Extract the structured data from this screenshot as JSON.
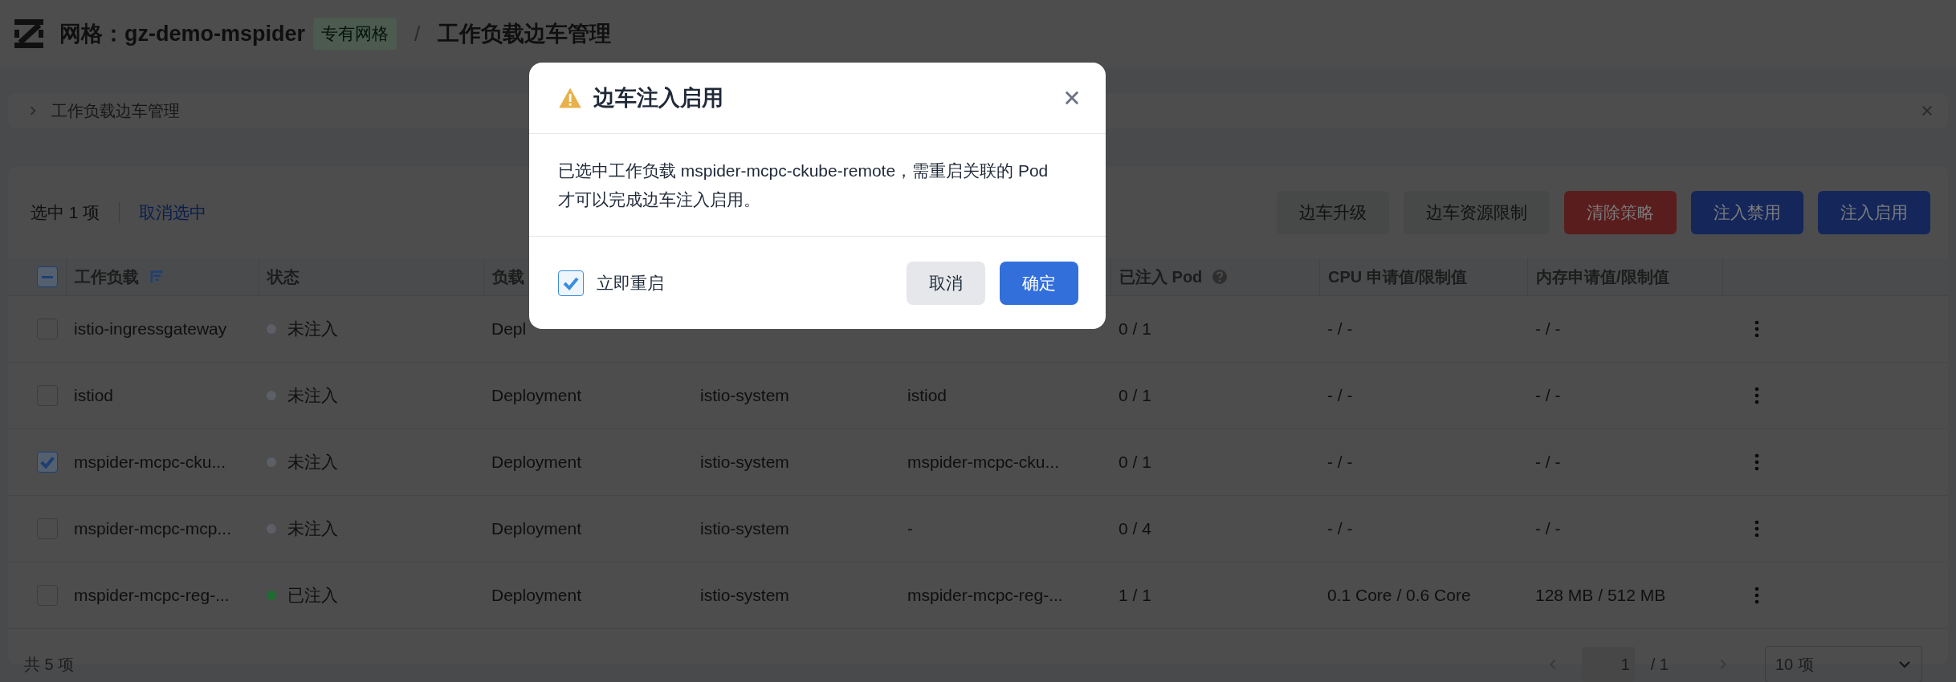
{
  "header": {
    "mesh_label": "网格：",
    "mesh_name": "gz-demo-mspider",
    "mesh_badge": "专有网格",
    "separator": "/",
    "page_title": "工作负载边车管理"
  },
  "panel": {
    "title": "工作负载边车管理",
    "expanded": false
  },
  "toolbar": {
    "selection_count": "选中 1 项",
    "clear_selection": "取消选中",
    "actions": [
      {
        "label": "边车升级",
        "kind": "default"
      },
      {
        "label": "边车资源限制",
        "kind": "default"
      },
      {
        "label": "清除策略",
        "kind": "danger"
      },
      {
        "label": "注入禁用",
        "kind": "primary"
      },
      {
        "label": "注入启用",
        "kind": "primary"
      }
    ]
  },
  "table": {
    "select_all": {
      "indeterminate": true
    },
    "columns": [
      {
        "label": "工作负载",
        "kind": "sortable"
      },
      {
        "label": "状态",
        "kind": "plain"
      },
      {
        "label": "负载",
        "kind": "plain"
      },
      {
        "kind": "plain"
      },
      {
        "kind": "plain"
      },
      {
        "label": "已注入 Pod",
        "kind": "help"
      },
      {
        "label": "CPU 申请值/限制值",
        "kind": "plain"
      },
      {
        "label": "内存申请值/限制值",
        "kind": "plain"
      }
    ],
    "rows": [
      {
        "selected": false,
        "name": "istio-ingressgateway",
        "status": "未注入",
        "color": "#5c5f66",
        "type": "Depl",
        "pods": "0 / 1",
        "cpu": "- / -",
        "memory": "- / -"
      },
      {
        "selected": false,
        "name": "istiod",
        "status": "未注入",
        "color": "#5c5f66",
        "type": "Deployment",
        "namespace": "istio-system",
        "service": "istiod",
        "pods": "0 / 1",
        "cpu": "- / -",
        "memory": "- / -"
      },
      {
        "selected": true,
        "name": "mspider-mcpc-cku...",
        "status": "未注入",
        "color": "#5c5f66",
        "type": "Deployment",
        "namespace": "istio-system",
        "service": "mspider-mcpc-cku...",
        "pods": "0 / 1",
        "cpu": "- / -",
        "memory": "- / -"
      },
      {
        "selected": false,
        "name": "mspider-mcpc-mcp...",
        "status": "未注入",
        "color": "#5c5f66",
        "type": "Deployment",
        "namespace": "istio-system",
        "service": "-",
        "pods": "0 / 4",
        "cpu": "- / -",
        "memory": "- / -"
      },
      {
        "selected": false,
        "name": "mspider-mcpc-reg-...",
        "status": "已注入",
        "color": "#1f6b33",
        "type": "Deployment",
        "namespace": "istio-system",
        "service": "mspider-mcpc-reg-...",
        "pods": "1 / 1",
        "cpu": "0.1 Core / 0.6 Core",
        "memory": "128 MB / 512 MB"
      }
    ]
  },
  "footer": {
    "total": "共 5 项",
    "page": "1",
    "page_total": "/ 1",
    "page_size": "10 项"
  },
  "dialog": {
    "title": "边车注入启用",
    "message": "已选中工作负载 mspider-mcpc-ckube-remote，需重启关联的 Pod 才可以完成边车注入启用。",
    "restart": {
      "label": "立即重启",
      "checked": true
    },
    "buttons": [
      {
        "label": "取消",
        "kind": "secondary"
      },
      {
        "label": "确定",
        "kind": "primary"
      }
    ]
  }
}
